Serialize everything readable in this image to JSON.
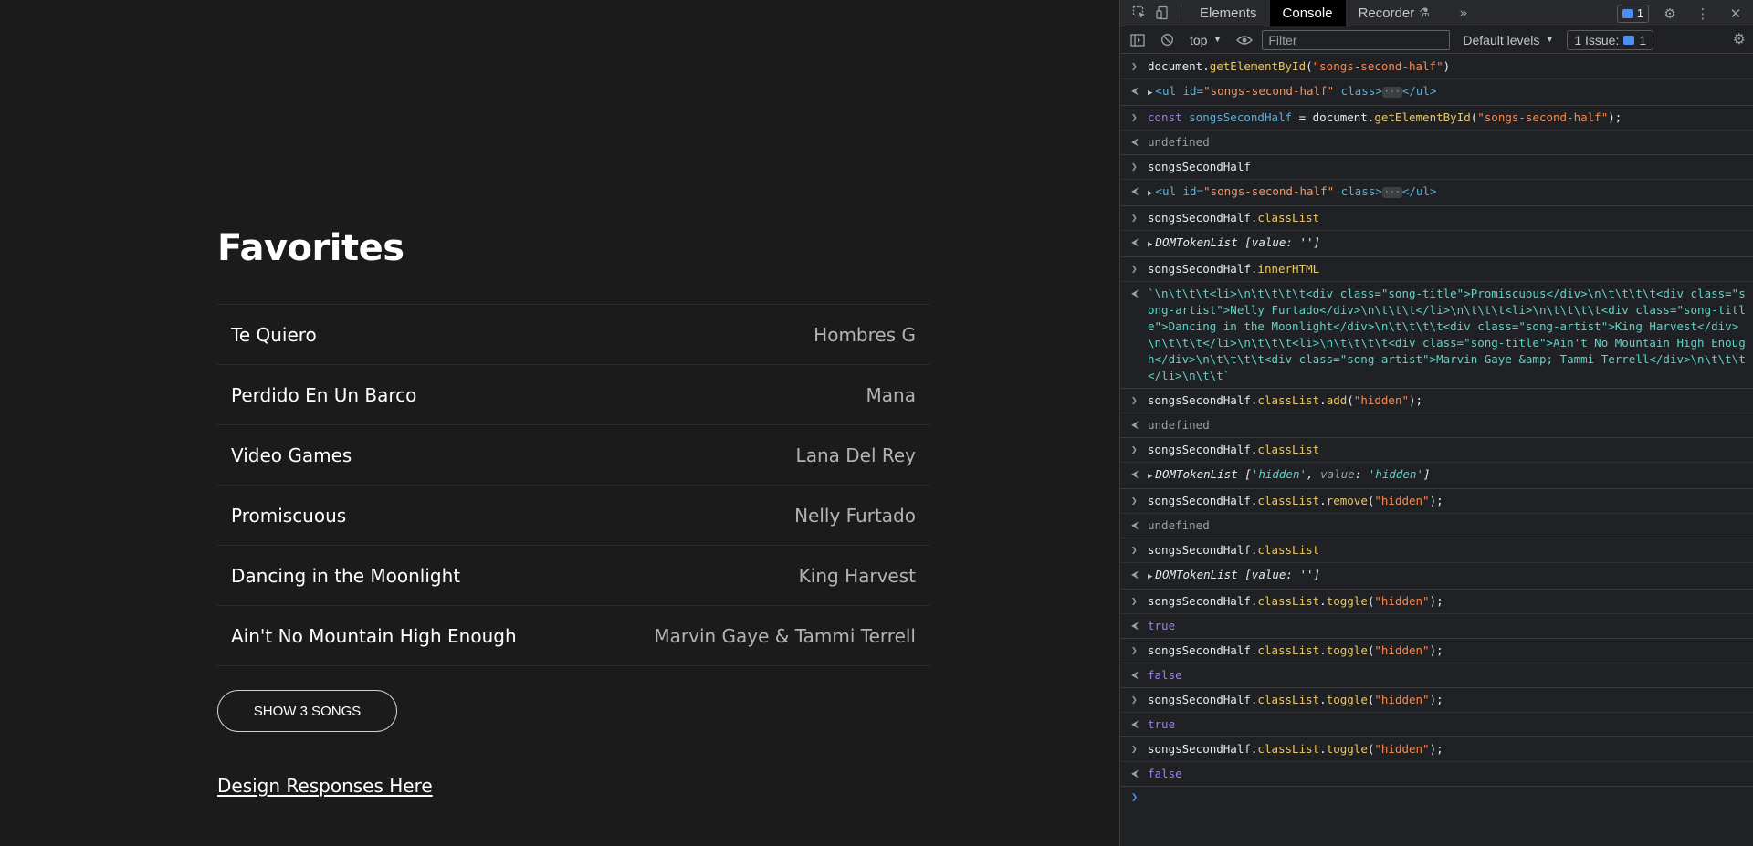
{
  "page": {
    "title": "Favorites",
    "songs": [
      {
        "title": "Te Quiero",
        "artist": "Hombres G"
      },
      {
        "title": "Perdido En Un Barco",
        "artist": "Mana"
      },
      {
        "title": "Video Games",
        "artist": "Lana Del Rey"
      },
      {
        "title": "Promiscuous",
        "artist": "Nelly Furtado"
      },
      {
        "title": "Dancing in the Moonlight",
        "artist": "King Harvest"
      },
      {
        "title": "Ain't No Mountain High Enough",
        "artist": "Marvin Gaye & Tammi Terrell"
      }
    ],
    "show_button": "SHOW 3 SONGS",
    "design_link": "Design Responses Here"
  },
  "devtools": {
    "tabs": [
      "Elements",
      "Console",
      "Recorder"
    ],
    "active_tab": "Console",
    "message_count": "1",
    "context": "top",
    "filter_placeholder": "Filter",
    "levels": "Default levels",
    "issue_label": "1 Issue:",
    "issue_count": "1",
    "console": {
      "undefined": "undefined",
      "true": "true",
      "false": "false",
      "id_str": "\"songs-second-half\"",
      "get_element": "document.",
      "get_element_fn": "getElementById",
      "var_name": "songsSecondHalf",
      "const_kw": "const ",
      "class_list": "classList",
      "inner_html": "innerHTML",
      "add": "add",
      "remove": "remove",
      "toggle": "toggle",
      "hidden_str": "\"hidden\"",
      "ul_open": "<ul id=",
      "ul_class": " class>",
      "ul_close": "</ul>",
      "token_list": "DOMTokenList",
      "token_empty": "[value: '']",
      "token_hidden_a": "'hidden'",
      "token_hidden_b": "'hidden'",
      "inner_html_value": "`\\n\\t\\t\\t<li>\\n\\t\\t\\t\\t<div class=\"song-title\">Promiscuous</div>\\n\\t\\t\\t\\t<div class=\"song-artist\">Nelly Furtado</div>\\n\\t\\t\\t</li>\\n\\t\\t\\t<li>\\n\\t\\t\\t\\t<div class=\"song-title\">Dancing in the Moonlight</div>\\n\\t\\t\\t\\t<div class=\"song-artist\">King Harvest</div>\\n\\t\\t\\t</li>\\n\\t\\t\\t<li>\\n\\t\\t\\t\\t<div class=\"song-title\">Ain't No Mountain High Enough</div>\\n\\t\\t\\t\\t<div class=\"song-artist\">Marvin Gaye &amp; Tammi Terrell</div>\\n\\t\\t\\t</li>\\n\\t\\t`"
    }
  }
}
